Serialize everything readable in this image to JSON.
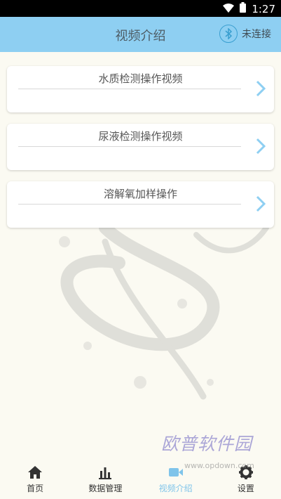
{
  "status": {
    "time": "1:27"
  },
  "header": {
    "title": "视频介绍",
    "bt_status": "未连接"
  },
  "list": [
    {
      "label": "水质检测操作视频"
    },
    {
      "label": "尿液检测操作视频"
    },
    {
      "label": "溶解氧加样操作"
    }
  ],
  "nav": [
    {
      "label": "首页",
      "icon": "home-icon"
    },
    {
      "label": "数据管理",
      "icon": "bar-chart-icon"
    },
    {
      "label": "视频介绍",
      "icon": "video-icon"
    },
    {
      "label": "设置",
      "icon": "gear-icon"
    }
  ],
  "watermark": {
    "text": "欧普软件园",
    "url": "www.opdown.com"
  },
  "colors": {
    "header": "#8ecff2",
    "accent": "#7fc4ea",
    "background": "#fbfaf2"
  }
}
